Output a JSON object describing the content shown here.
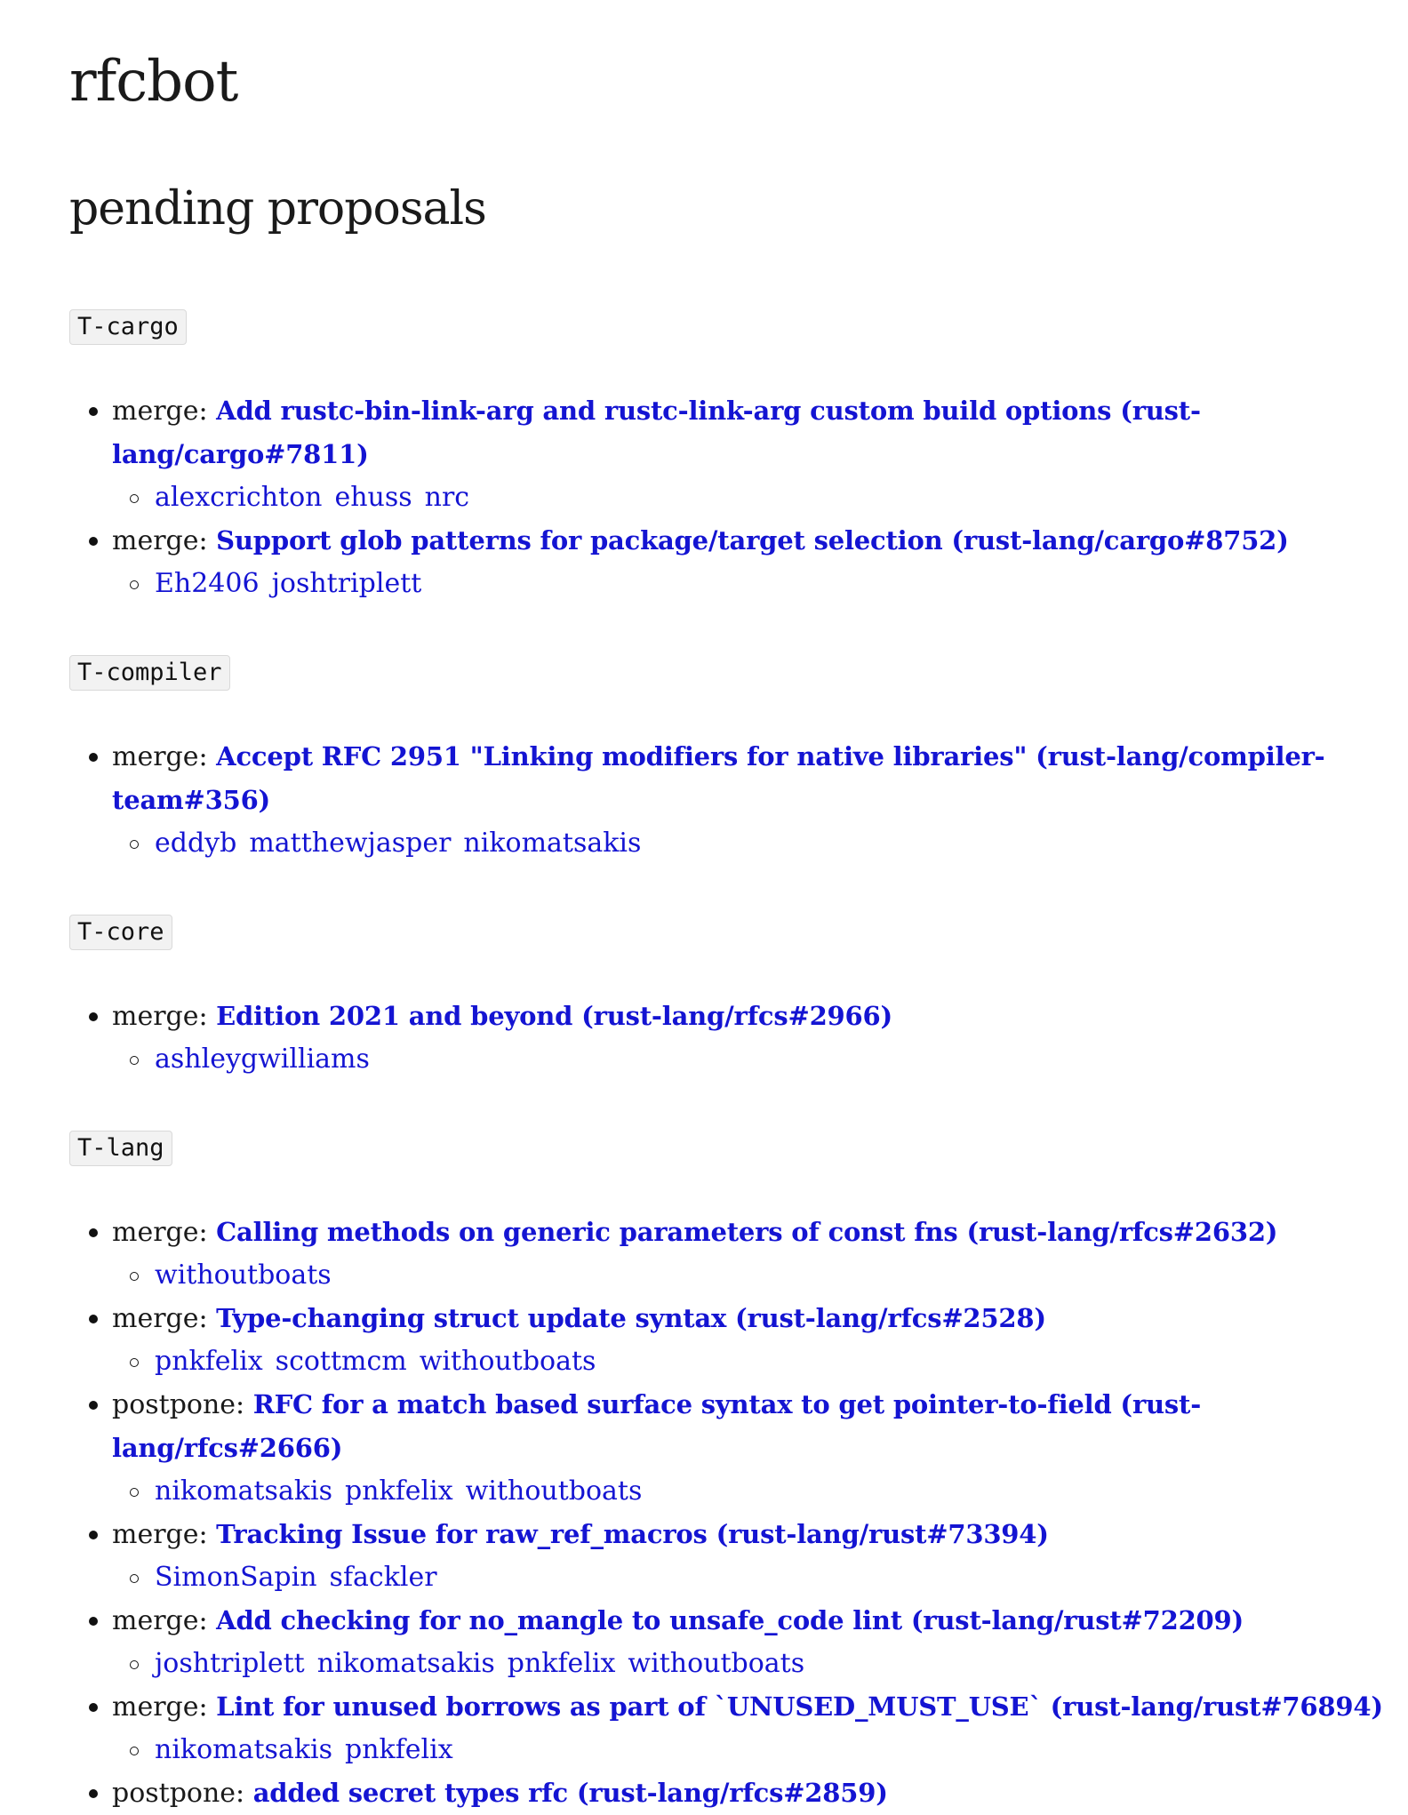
{
  "title": "rfcbot",
  "section_title": "pending proposals",
  "teams": [
    {
      "label": "T-cargo",
      "proposals": [
        {
          "disposition": "merge:",
          "title": "Add rustc-bin-link-arg and rustc-link-arg custom build options (rust-lang/cargo#7811)",
          "reviewers": [
            "alexcrichton",
            "ehuss",
            "nrc"
          ]
        },
        {
          "disposition": "merge:",
          "title": "Support glob patterns for package/target selection (rust-lang/cargo#8752)",
          "reviewers": [
            "Eh2406",
            "joshtriplett"
          ]
        }
      ]
    },
    {
      "label": "T-compiler",
      "proposals": [
        {
          "disposition": "merge:",
          "title": "Accept RFC 2951 \"Linking modifiers for native libraries\" (rust-lang/compiler-team#356)",
          "reviewers": [
            "eddyb",
            "matthewjasper",
            "nikomatsakis"
          ]
        }
      ]
    },
    {
      "label": "T-core",
      "proposals": [
        {
          "disposition": "merge:",
          "title": "Edition 2021 and beyond (rust-lang/rfcs#2966)",
          "reviewers": [
            "ashleygwilliams"
          ]
        }
      ]
    },
    {
      "label": "T-lang",
      "proposals": [
        {
          "disposition": "merge:",
          "title": "Calling methods on generic parameters of const fns (rust-lang/rfcs#2632)",
          "reviewers": [
            "withoutboats"
          ]
        },
        {
          "disposition": "merge:",
          "title": "Type-changing struct update syntax (rust-lang/rfcs#2528)",
          "reviewers": [
            "pnkfelix",
            "scottmcm",
            "withoutboats"
          ]
        },
        {
          "disposition": "postpone:",
          "title": "RFC for a match based surface syntax to get pointer-to-field (rust-lang/rfcs#2666)",
          "reviewers": [
            "nikomatsakis",
            "pnkfelix",
            "withoutboats"
          ]
        },
        {
          "disposition": "merge:",
          "title": "Tracking Issue for raw_ref_macros (rust-lang/rust#73394)",
          "reviewers": [
            "SimonSapin",
            "sfackler"
          ]
        },
        {
          "disposition": "merge:",
          "title": "Add checking for no_mangle to unsafe_code lint (rust-lang/rust#72209)",
          "reviewers": [
            "joshtriplett",
            "nikomatsakis",
            "pnkfelix",
            "withoutboats"
          ]
        },
        {
          "disposition": "merge:",
          "title": "Lint for unused borrows as part of `UNUSED_MUST_USE` (rust-lang/rust#76894)",
          "reviewers": [
            "nikomatsakis",
            "pnkfelix"
          ]
        },
        {
          "disposition": "postpone:",
          "title": "added secret types rfc (rust-lang/rfcs#2859)",
          "reviewers": []
        }
      ]
    }
  ]
}
